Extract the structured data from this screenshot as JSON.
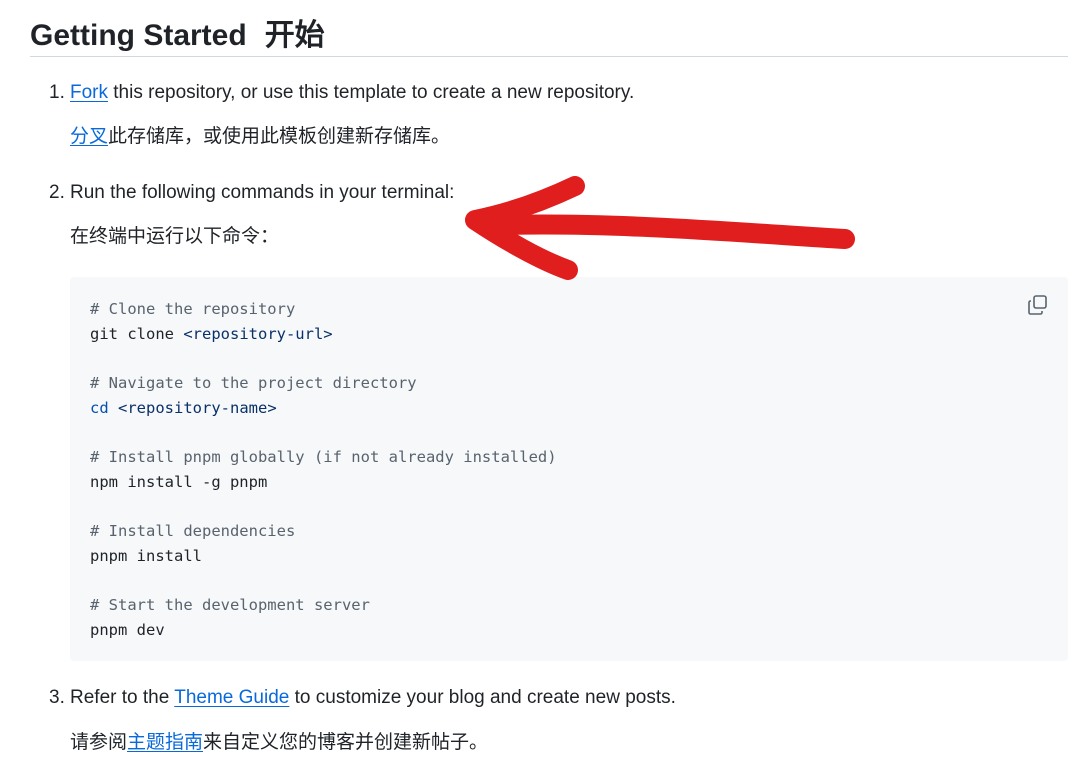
{
  "heading": {
    "title": "Getting Started",
    "title_zh": "开始"
  },
  "steps": [
    {
      "number": "1.",
      "link_text": "Fork",
      "text": " this repository, or use this template to create a new repository.",
      "zh_link_text": "分叉",
      "zh_text": "此存储库，或使用此模板创建新存储库。"
    },
    {
      "number": "2.",
      "text": "Run the following commands in your terminal:",
      "zh_text": "在终端中运行以下命令："
    },
    {
      "number": "3.",
      "text_before": "Refer to the ",
      "link_text": "Theme Guide",
      "text_after": " to customize your blog and create new posts.",
      "zh_before": "请参阅",
      "zh_link_text": "主题指南",
      "zh_after": "来自定义您的博客并创建新帖子。"
    }
  ],
  "code": {
    "comment_clone": "# Clone the repository",
    "git_clone": "git clone ",
    "repo_url": "<repository-url>",
    "comment_navigate": "# Navigate to the project directory",
    "cd": "cd",
    "repo_name": "<repository-name>",
    "comment_pnpm": "# Install pnpm globally (if not already installed)",
    "npm_install": "npm install -g pnpm",
    "comment_deps": "# Install dependencies",
    "pnpm_install": "pnpm install",
    "comment_dev": "# Start the development server",
    "pnpm_dev": "pnpm dev"
  },
  "icons": {
    "copy": "copy-icon",
    "annotation": "red-arrow-annotation"
  },
  "colors": {
    "link": "#0969da",
    "code_bg": "#f6f8fa",
    "annotation": "#e01e1e"
  }
}
